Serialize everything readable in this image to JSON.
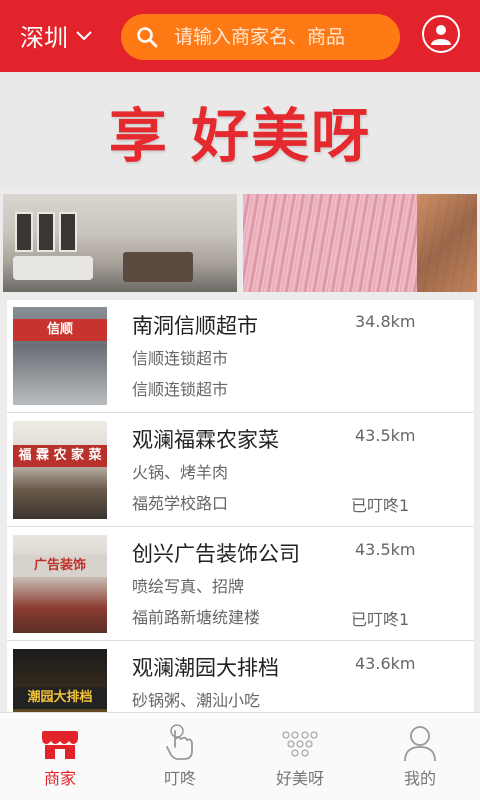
{
  "header": {
    "city": "深圳",
    "search_placeholder": "请输入商家名、商品"
  },
  "banner": {
    "text": "享 好美呀"
  },
  "merchants": [
    {
      "name": "南洞信顺超市",
      "distance": "34.8km",
      "tags": "信顺连锁超市",
      "address": "信顺连锁超市",
      "dingdong": "",
      "thumb_sign": "信顺",
      "thumb_color": "#c8332d"
    },
    {
      "name": "观澜福霖农家菜",
      "distance": "43.5km",
      "tags": "火锅、烤羊肉",
      "address": "福苑学校路口",
      "dingdong": "已叮咚1",
      "thumb_sign": "福 霖 农 家 菜",
      "thumb_color": "#b8322b"
    },
    {
      "name": "创兴广告装饰公司",
      "distance": "43.5km",
      "tags": "喷绘写真、招牌",
      "address": "福前路新塘统建楼",
      "dingdong": "已叮咚1",
      "thumb_sign": "广告装饰",
      "thumb_color": "#d7d3cc"
    },
    {
      "name": "观澜潮园大排档",
      "distance": "43.6km",
      "tags": "砂锅粥、潮汕小吃",
      "address": "",
      "dingdong": "",
      "thumb_sign": "潮园大排档",
      "thumb_color": "#222222"
    }
  ],
  "nav": {
    "items": [
      {
        "label": "商家",
        "icon": "shop-icon",
        "active": true
      },
      {
        "label": "叮咚",
        "icon": "tap-hand-icon",
        "active": false
      },
      {
        "label": "好美呀",
        "icon": "dots-grid-icon",
        "active": false
      },
      {
        "label": "我的",
        "icon": "person-icon",
        "active": false
      }
    ]
  },
  "colors": {
    "brand_red": "#e3232b",
    "search_orange": "#ff7a14"
  }
}
